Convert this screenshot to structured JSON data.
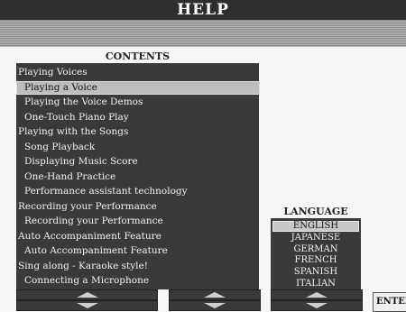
{
  "window": {
    "title": "HELP"
  },
  "contents": {
    "title": "CONTENTS",
    "items": [
      {
        "label": "Playing Voices",
        "indent": false,
        "selected": false
      },
      {
        "label": "Playing a Voice",
        "indent": true,
        "selected": true
      },
      {
        "label": "Playing the Voice Demos",
        "indent": true,
        "selected": false
      },
      {
        "label": "One-Touch Piano Play",
        "indent": true,
        "selected": false
      },
      {
        "label": "Playing with the Songs",
        "indent": false,
        "selected": false
      },
      {
        "label": "Song Playback",
        "indent": true,
        "selected": false
      },
      {
        "label": "Displaying Music Score",
        "indent": true,
        "selected": false
      },
      {
        "label": "One-Hand Practice",
        "indent": true,
        "selected": false
      },
      {
        "label": "Performance assistant technology",
        "indent": true,
        "selected": false
      },
      {
        "label": "Recording your Performance",
        "indent": false,
        "selected": false
      },
      {
        "label": "Recording your Performance",
        "indent": true,
        "selected": false
      },
      {
        "label": "Auto Accompaniment Feature",
        "indent": false,
        "selected": false
      },
      {
        "label": "Auto Accompaniment Feature",
        "indent": true,
        "selected": false
      },
      {
        "label": "Sing along - Karaoke style!",
        "indent": false,
        "selected": false
      },
      {
        "label": "Connecting a Microphone",
        "indent": true,
        "selected": false
      }
    ]
  },
  "language": {
    "title": "LANGUAGE",
    "items": [
      {
        "label": "ENGLISH",
        "selected": true
      },
      {
        "label": "JAPANESE",
        "selected": false
      },
      {
        "label": "GERMAN",
        "selected": false
      },
      {
        "label": "FRENCH",
        "selected": false
      },
      {
        "label": "SPANISH",
        "selected": false
      },
      {
        "label": "ITALIAN",
        "selected": false
      }
    ]
  },
  "buttons": {
    "enter_label": "ENTER"
  }
}
